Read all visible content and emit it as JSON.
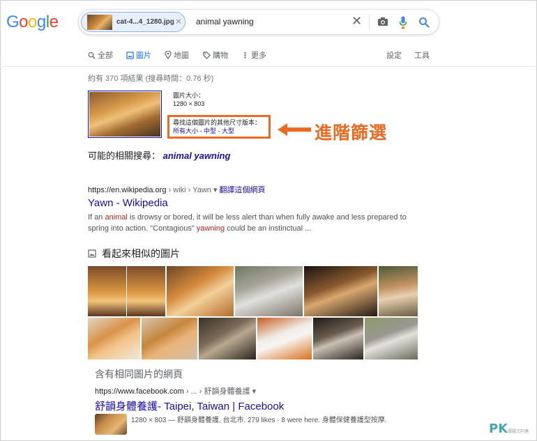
{
  "logo": {
    "letters": [
      "G",
      "o",
      "o",
      "g",
      "l",
      "e"
    ],
    "colors": [
      "#4285f4",
      "#ea4335",
      "#fbbc05",
      "#4285f4",
      "#34a853",
      "#ea4335"
    ]
  },
  "search": {
    "chip_label": "cat-4...4_1280.jpg",
    "query": "animal yawning",
    "icons": [
      "close-icon",
      "camera-icon",
      "microphone-icon",
      "search-icon"
    ]
  },
  "nav": {
    "items": [
      {
        "label": "全部",
        "icon": "search-icon"
      },
      {
        "label": "圖片",
        "icon": "image-icon"
      },
      {
        "label": "地圖",
        "icon": "pin-icon"
      },
      {
        "label": "購物",
        "icon": "tag-icon"
      },
      {
        "label": "更多",
        "icon": "more-icon"
      }
    ],
    "settings": "設定",
    "tools": "工具"
  },
  "stats": "約有 370 項結果 (搜尋時間：0.76 秒)",
  "image_info": {
    "size_label": "圖片大小：",
    "size_value": "1280 × 803",
    "other_sizes_text": "尋找這個圖片的其他尺寸版本：",
    "link_all": "所有大小",
    "sep1": " - ",
    "link_medium": "中型",
    "sep2": " - ",
    "link_large": "大型"
  },
  "annotation": {
    "label": "進階篩選",
    "color": "#ec6b24"
  },
  "related": {
    "prefix": "可能的相關搜尋：",
    "link": "animal yawning"
  },
  "result1": {
    "url": "https://en.wikipedia.org",
    "crumbs": " › wiki › Yawn",
    "translate": "翻譯這個網頁",
    "title": "Yawn - Wikipedia",
    "snippet_parts": [
      "If an ",
      "animal",
      " is drowsy or bored, it will be less alert than when fully awake and less prepared to spring into action. \"Contagious\" ",
      "yawning",
      " could be an instinctual ..."
    ]
  },
  "similar": {
    "heading": "看起來相似的圖片"
  },
  "pages": {
    "heading": "含有相同圖片的網頁",
    "url": "https://www.facebook.com",
    "crumbs": " › ... › 舒韻身體養護",
    "title": "舒韻身體養護- Taipei, Taiwan | Facebook",
    "snippet": "1280 × 803 — 舒韻身體養護, 台北市. 279 likes · 8 were here. 身體保健養護型按摩."
  },
  "watermark": {
    "text": "PK",
    "sub": "電腦王阿達"
  }
}
